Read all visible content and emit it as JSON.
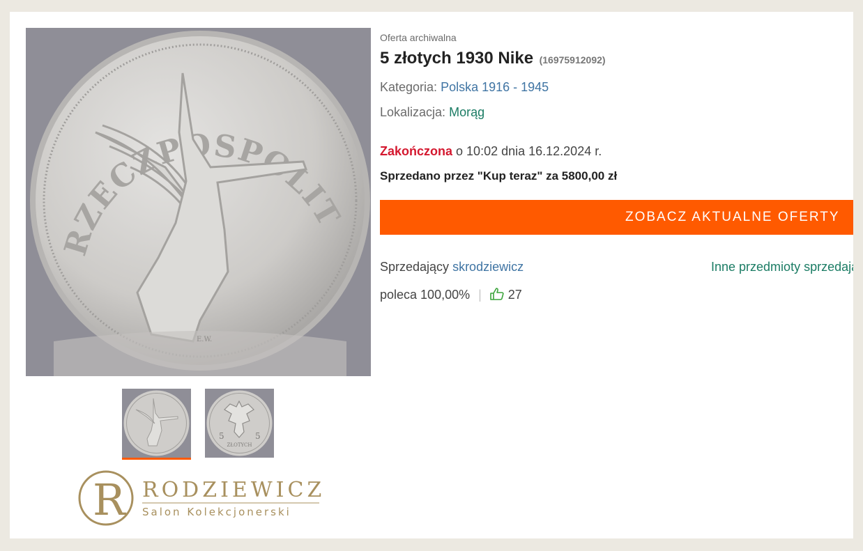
{
  "listing": {
    "archived_label": "Oferta archiwalna",
    "title": "5 złotych 1930 Nike",
    "offer_id": "(16975912092)",
    "category_label": "Kategoria:",
    "category_value": "Polska 1916 - 1945",
    "location_label": "Lokalizacja:",
    "location_value": "Morąg",
    "ended_label": "Zakończona",
    "ended_rest": " o 10:02 dnia 16.12.2024 r.",
    "sold_text": "Sprzedano przez \"Kup teraz\" za 5800,00 zł",
    "cta_label": "ZOBACZ AKTUALNE OFERTY"
  },
  "coin_obverse": {
    "legend": "RZECZPOSPOLITA POLSKA",
    "signature": "E.W."
  },
  "coin_reverse": {
    "denomination": "5",
    "unit": "ZŁOTYCH"
  },
  "seller": {
    "label": "Sprzedający ",
    "name": "skrodziewicz",
    "other_items": "Inne przedmioty sprzedającego",
    "recommend": "poleca 100,00%",
    "separator": "|",
    "likes": "27"
  },
  "logo": {
    "letter": "R",
    "name": "RODZIEWICZ",
    "tagline": "Salon Kolekcjonerski"
  },
  "colors": {
    "accent": "#ff5a00",
    "link_blue": "#3f74a3",
    "link_green": "#1b7c64",
    "ended_red": "#d4182f",
    "logo_gold": "#a8905e"
  }
}
